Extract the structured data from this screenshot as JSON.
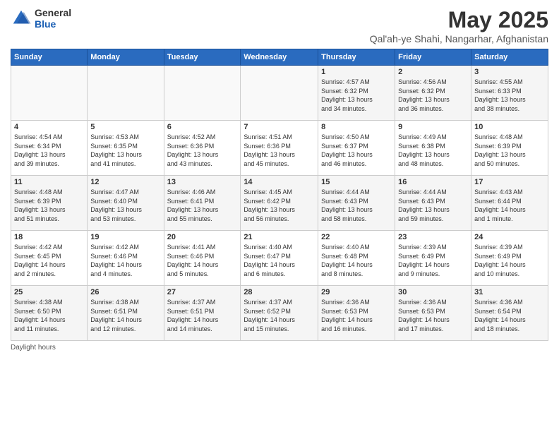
{
  "header": {
    "logo_general": "General",
    "logo_blue": "Blue",
    "month_title": "May 2025",
    "location": "Qal'ah-ye Shahi, Nangarhar, Afghanistan"
  },
  "days_of_week": [
    "Sunday",
    "Monday",
    "Tuesday",
    "Wednesday",
    "Thursday",
    "Friday",
    "Saturday"
  ],
  "footer": {
    "label": "Daylight hours"
  },
  "weeks": [
    [
      {
        "day": "",
        "detail": ""
      },
      {
        "day": "",
        "detail": ""
      },
      {
        "day": "",
        "detail": ""
      },
      {
        "day": "",
        "detail": ""
      },
      {
        "day": "1",
        "detail": "Sunrise: 4:57 AM\nSunset: 6:32 PM\nDaylight: 13 hours\nand 34 minutes."
      },
      {
        "day": "2",
        "detail": "Sunrise: 4:56 AM\nSunset: 6:32 PM\nDaylight: 13 hours\nand 36 minutes."
      },
      {
        "day": "3",
        "detail": "Sunrise: 4:55 AM\nSunset: 6:33 PM\nDaylight: 13 hours\nand 38 minutes."
      }
    ],
    [
      {
        "day": "4",
        "detail": "Sunrise: 4:54 AM\nSunset: 6:34 PM\nDaylight: 13 hours\nand 39 minutes."
      },
      {
        "day": "5",
        "detail": "Sunrise: 4:53 AM\nSunset: 6:35 PM\nDaylight: 13 hours\nand 41 minutes."
      },
      {
        "day": "6",
        "detail": "Sunrise: 4:52 AM\nSunset: 6:36 PM\nDaylight: 13 hours\nand 43 minutes."
      },
      {
        "day": "7",
        "detail": "Sunrise: 4:51 AM\nSunset: 6:36 PM\nDaylight: 13 hours\nand 45 minutes."
      },
      {
        "day": "8",
        "detail": "Sunrise: 4:50 AM\nSunset: 6:37 PM\nDaylight: 13 hours\nand 46 minutes."
      },
      {
        "day": "9",
        "detail": "Sunrise: 4:49 AM\nSunset: 6:38 PM\nDaylight: 13 hours\nand 48 minutes."
      },
      {
        "day": "10",
        "detail": "Sunrise: 4:48 AM\nSunset: 6:39 PM\nDaylight: 13 hours\nand 50 minutes."
      }
    ],
    [
      {
        "day": "11",
        "detail": "Sunrise: 4:48 AM\nSunset: 6:39 PM\nDaylight: 13 hours\nand 51 minutes."
      },
      {
        "day": "12",
        "detail": "Sunrise: 4:47 AM\nSunset: 6:40 PM\nDaylight: 13 hours\nand 53 minutes."
      },
      {
        "day": "13",
        "detail": "Sunrise: 4:46 AM\nSunset: 6:41 PM\nDaylight: 13 hours\nand 55 minutes."
      },
      {
        "day": "14",
        "detail": "Sunrise: 4:45 AM\nSunset: 6:42 PM\nDaylight: 13 hours\nand 56 minutes."
      },
      {
        "day": "15",
        "detail": "Sunrise: 4:44 AM\nSunset: 6:43 PM\nDaylight: 13 hours\nand 58 minutes."
      },
      {
        "day": "16",
        "detail": "Sunrise: 4:44 AM\nSunset: 6:43 PM\nDaylight: 13 hours\nand 59 minutes."
      },
      {
        "day": "17",
        "detail": "Sunrise: 4:43 AM\nSunset: 6:44 PM\nDaylight: 14 hours\nand 1 minute."
      }
    ],
    [
      {
        "day": "18",
        "detail": "Sunrise: 4:42 AM\nSunset: 6:45 PM\nDaylight: 14 hours\nand 2 minutes."
      },
      {
        "day": "19",
        "detail": "Sunrise: 4:42 AM\nSunset: 6:46 PM\nDaylight: 14 hours\nand 4 minutes."
      },
      {
        "day": "20",
        "detail": "Sunrise: 4:41 AM\nSunset: 6:46 PM\nDaylight: 14 hours\nand 5 minutes."
      },
      {
        "day": "21",
        "detail": "Sunrise: 4:40 AM\nSunset: 6:47 PM\nDaylight: 14 hours\nand 6 minutes."
      },
      {
        "day": "22",
        "detail": "Sunrise: 4:40 AM\nSunset: 6:48 PM\nDaylight: 14 hours\nand 8 minutes."
      },
      {
        "day": "23",
        "detail": "Sunrise: 4:39 AM\nSunset: 6:49 PM\nDaylight: 14 hours\nand 9 minutes."
      },
      {
        "day": "24",
        "detail": "Sunrise: 4:39 AM\nSunset: 6:49 PM\nDaylight: 14 hours\nand 10 minutes."
      }
    ],
    [
      {
        "day": "25",
        "detail": "Sunrise: 4:38 AM\nSunset: 6:50 PM\nDaylight: 14 hours\nand 11 minutes."
      },
      {
        "day": "26",
        "detail": "Sunrise: 4:38 AM\nSunset: 6:51 PM\nDaylight: 14 hours\nand 12 minutes."
      },
      {
        "day": "27",
        "detail": "Sunrise: 4:37 AM\nSunset: 6:51 PM\nDaylight: 14 hours\nand 14 minutes."
      },
      {
        "day": "28",
        "detail": "Sunrise: 4:37 AM\nSunset: 6:52 PM\nDaylight: 14 hours\nand 15 minutes."
      },
      {
        "day": "29",
        "detail": "Sunrise: 4:36 AM\nSunset: 6:53 PM\nDaylight: 14 hours\nand 16 minutes."
      },
      {
        "day": "30",
        "detail": "Sunrise: 4:36 AM\nSunset: 6:53 PM\nDaylight: 14 hours\nand 17 minutes."
      },
      {
        "day": "31",
        "detail": "Sunrise: 4:36 AM\nSunset: 6:54 PM\nDaylight: 14 hours\nand 18 minutes."
      }
    ]
  ]
}
